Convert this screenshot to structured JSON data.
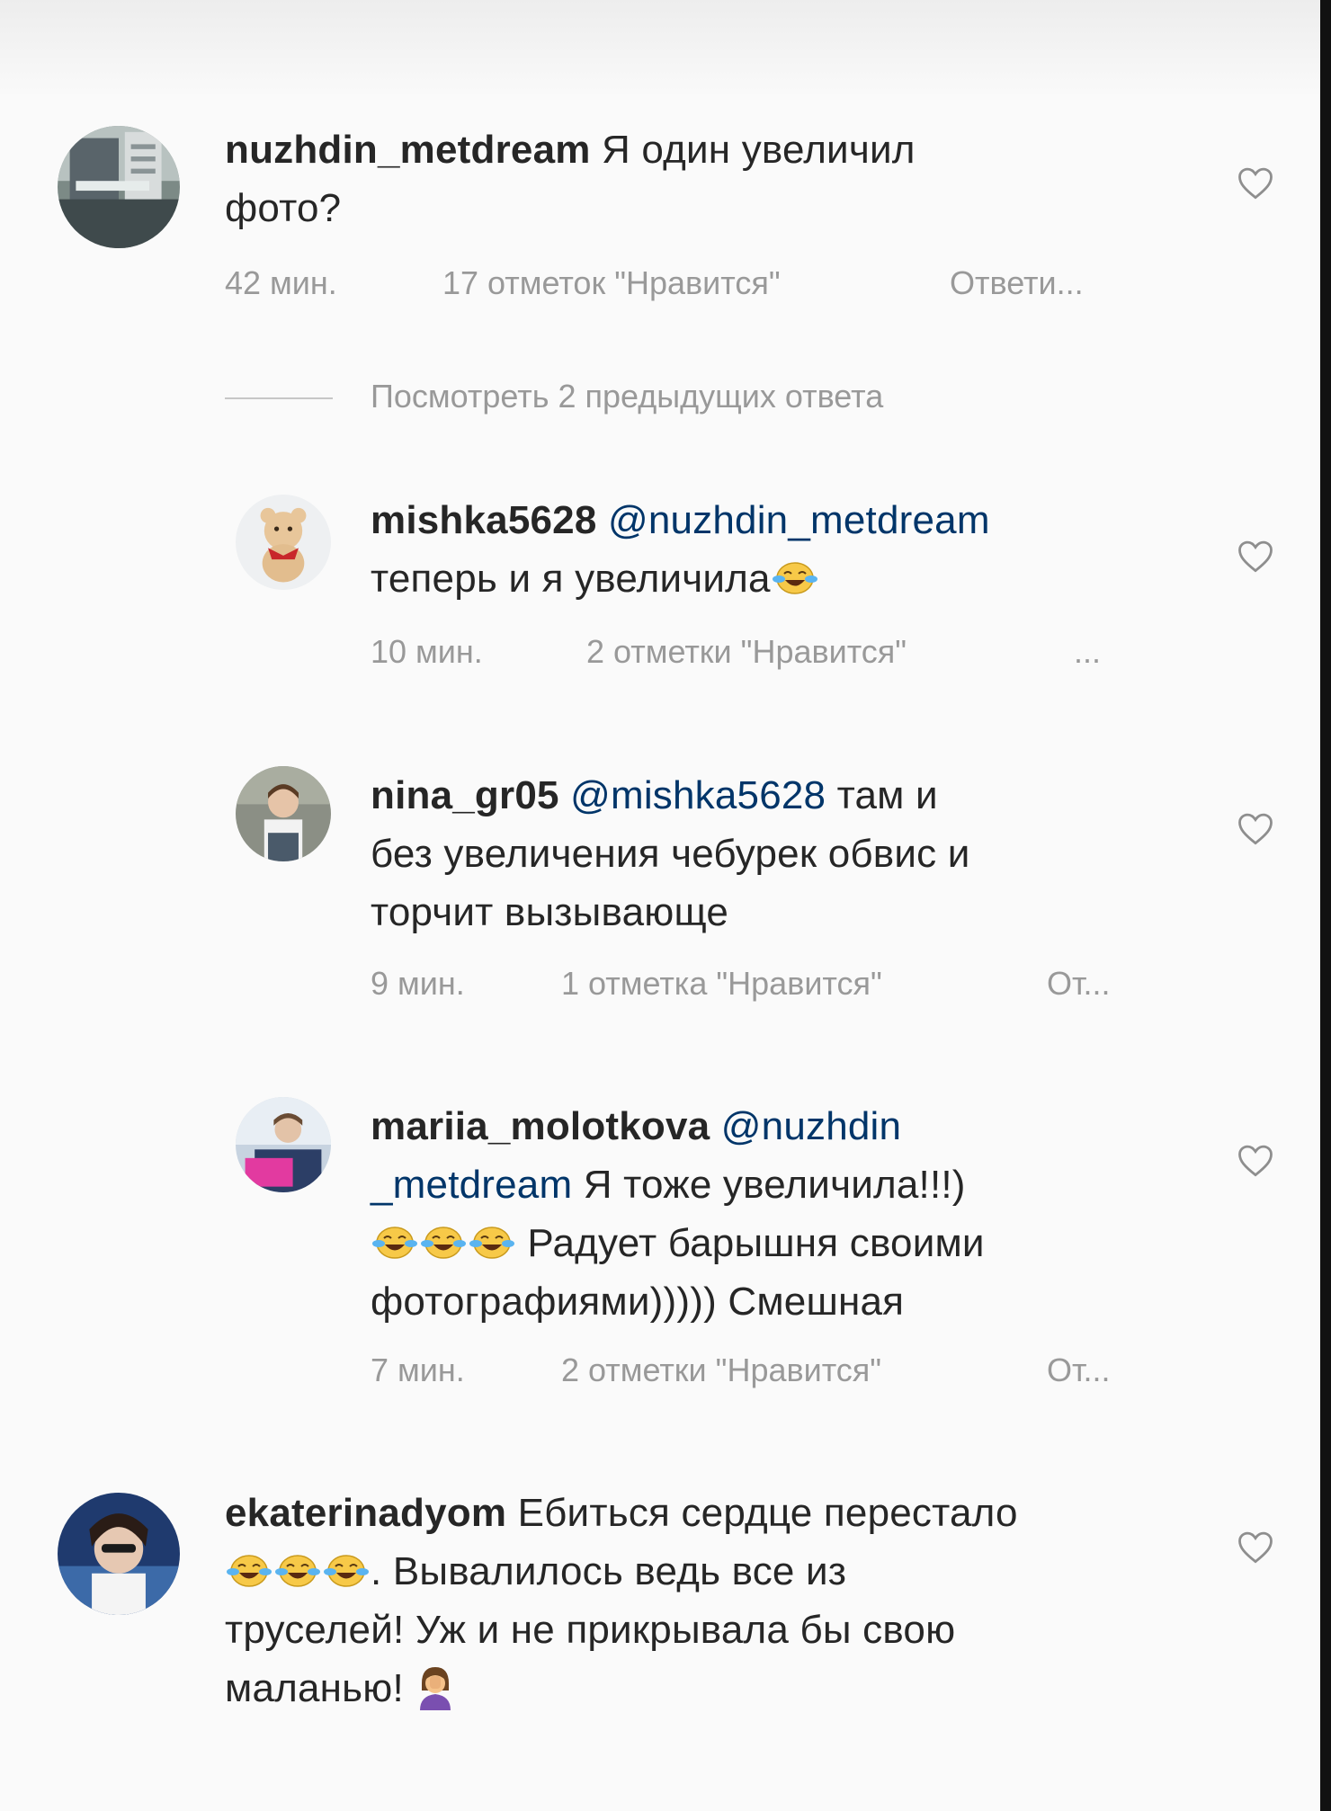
{
  "comments": [
    {
      "username": "nuzhdin_metdream",
      "text_line1": " Я один увеличил",
      "text_line2": "фото?",
      "time": "42 мин.",
      "likes": "17 отметок \"Нравится\"",
      "reply": "Ответи..."
    },
    {
      "username": "mishka5628",
      "mention": " @nuzhdin_metdream",
      "text_line2": "теперь и я увеличила",
      "time": "10 мин.",
      "likes": "2 отметки \"Нравится\"",
      "reply": "..."
    },
    {
      "username": "nina_gr05",
      "mention": " @mishka5628",
      "text_line1": " там и",
      "text_line2": "без увеличения чебурек обвис и",
      "text_line3": "торчит вызывающе",
      "time": "9 мин.",
      "likes": "1 отметка \"Нравится\"",
      "reply": "От..."
    },
    {
      "username": "mariia_molotkova",
      "mention1": " @nuzhdin",
      "mention2": "_metdream",
      "text_line2": " Я тоже увеличила!!!)",
      "text_line3": " Радует барышня своими",
      "text_line4": "фотографиями))))) Смешная",
      "time": "7 мин.",
      "likes": "2 отметки \"Нравится\"",
      "reply": "От..."
    },
    {
      "username": "ekaterinadyom",
      "text_line1": " Ебиться сердце перестало",
      "text_line2": ". Вывалилось ведь все из",
      "text_line3": "труселей! Уж и не прикрывала бы свою",
      "text_line4": "маланью! "
    }
  ],
  "view_previous_replies": "Посмотреть 2 предыдущих ответа",
  "icons": {
    "like": "heart-outline-icon",
    "laugh": "face-with-tears-of-joy-icon",
    "facepalm": "woman-facepalming-icon"
  },
  "colors": {
    "text": "#262626",
    "meta": "#999999",
    "mention": "#003569",
    "background": "#fafafa"
  }
}
